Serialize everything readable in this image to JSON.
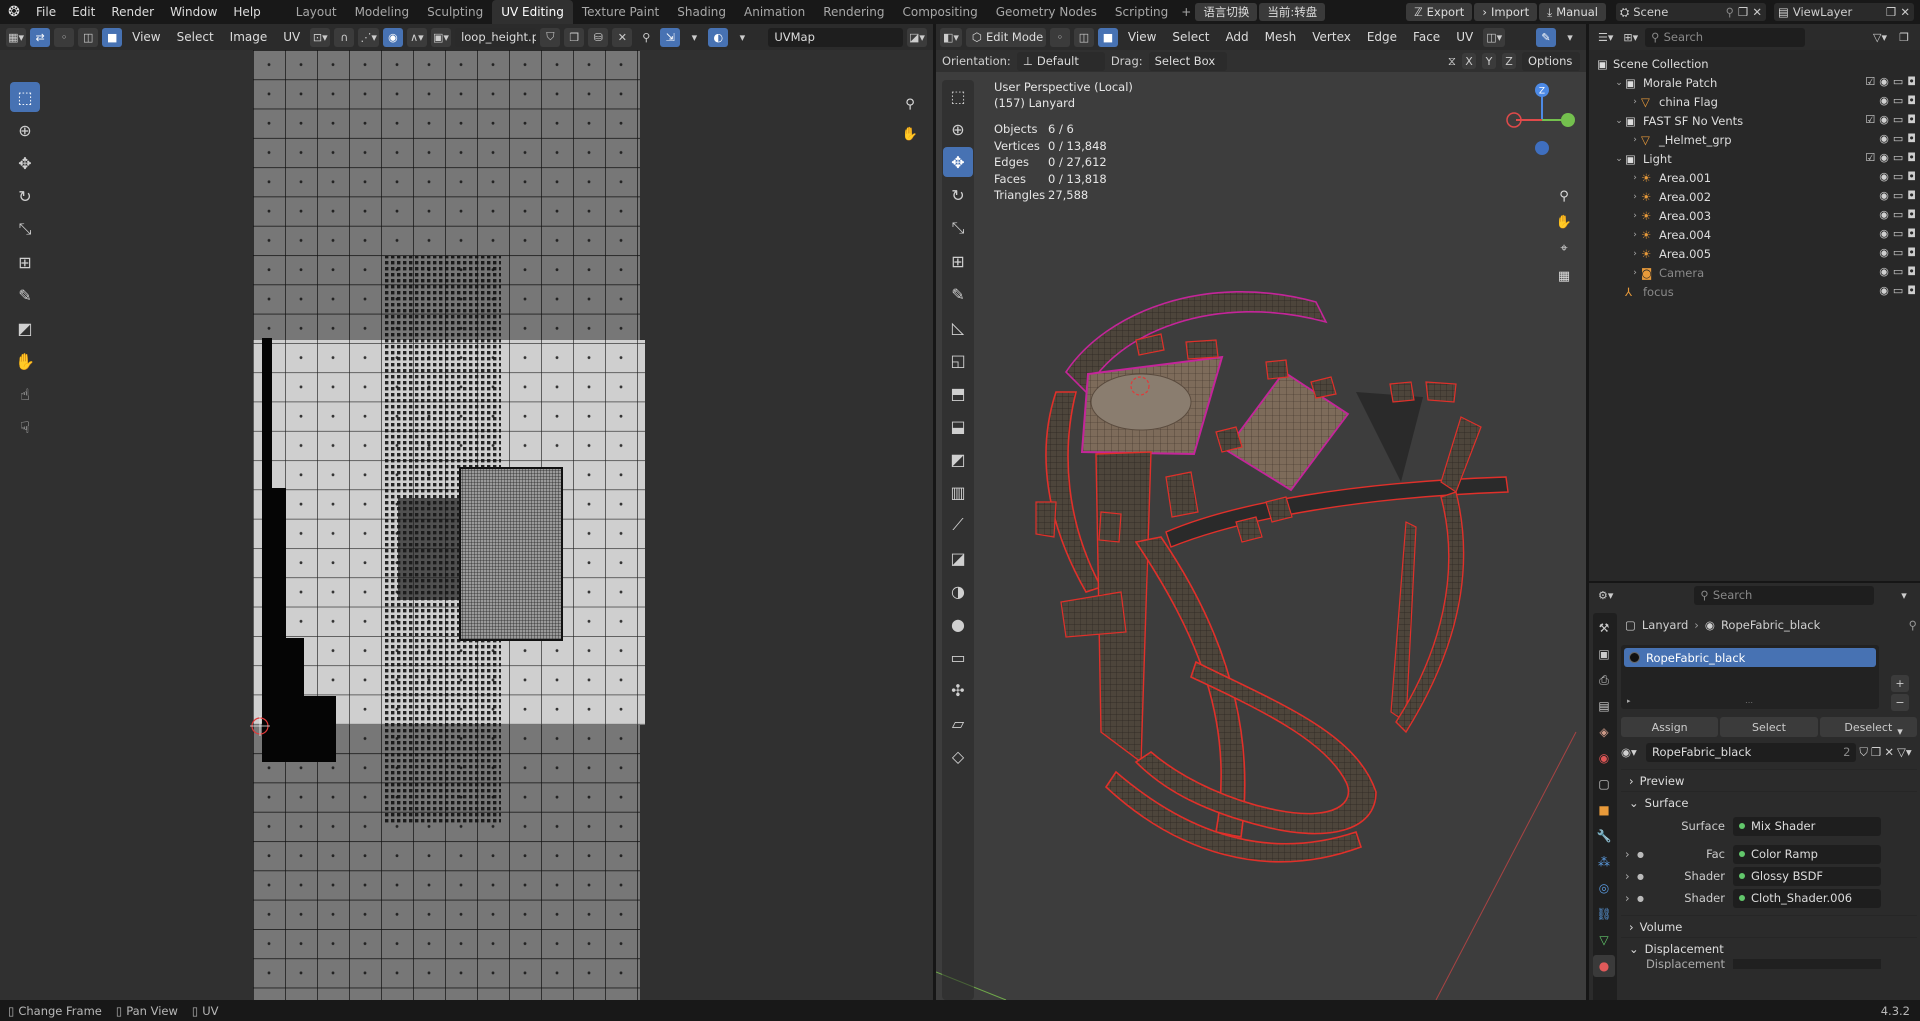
{
  "topbar": {
    "menus": [
      "File",
      "Edit",
      "Render",
      "Window",
      "Help"
    ],
    "workspaces": [
      "Layout",
      "Modeling",
      "Sculpting",
      "UV Editing",
      "Texture Paint",
      "Shading",
      "Animation",
      "Rendering",
      "Compositing",
      "Geometry Nodes",
      "Scripting"
    ],
    "active_workspace": "UV Editing",
    "plus": "+",
    "lang_switch": "语言切换",
    "lang_current": "当前:转盘",
    "export": "Export",
    "import": "Import",
    "manual": "Manual",
    "scene": "Scene",
    "view_layer": "ViewLayer"
  },
  "uv_editor": {
    "menus": [
      "View",
      "Select",
      "Image",
      "UV"
    ],
    "image_name": "loop_height.png",
    "uvmap": "UVMap"
  },
  "viewport": {
    "mode": "Edit Mode",
    "menus": [
      "View",
      "Select",
      "Add",
      "Mesh",
      "Vertex",
      "Edge",
      "Face",
      "UV"
    ],
    "orientation_label": "Orientation:",
    "orientation_value": "Default",
    "drag_label": "Drag:",
    "drag_value": "Select Box",
    "options": "Options",
    "axes": [
      "X",
      "Y",
      "Z"
    ],
    "perspective": "User Perspective (Local)",
    "object": "(157) Lanyard",
    "stats": [
      {
        "k": "Objects",
        "v": "6 / 6"
      },
      {
        "k": "Vertices",
        "v": "0 / 13,848"
      },
      {
        "k": "Edges",
        "v": "0 / 27,612"
      },
      {
        "k": "Faces",
        "v": "0 / 13,818"
      },
      {
        "k": "Triangles",
        "v": "27,588"
      }
    ],
    "gizmo_z": "Z"
  },
  "outliner": {
    "search_placeholder": "Search",
    "root": "Scene Collection",
    "rows": [
      {
        "label": "Morale Patch",
        "indent": 1,
        "type": "collection"
      },
      {
        "label": "china Flag",
        "indent": 2,
        "type": "object"
      },
      {
        "label": "FAST SF No Vents",
        "indent": 1,
        "type": "collection"
      },
      {
        "label": "_Helmet_grp",
        "indent": 2,
        "type": "object"
      },
      {
        "label": "Light",
        "indent": 1,
        "type": "collection"
      },
      {
        "label": "Area.001",
        "indent": 2,
        "type": "light"
      },
      {
        "label": "Area.002",
        "indent": 2,
        "type": "light"
      },
      {
        "label": "Area.003",
        "indent": 2,
        "type": "light"
      },
      {
        "label": "Area.004",
        "indent": 2,
        "type": "light"
      },
      {
        "label": "Area.005",
        "indent": 2,
        "type": "light"
      },
      {
        "label": "Camera",
        "indent": 2,
        "type": "camera"
      },
      {
        "label": "focus",
        "indent": 1,
        "type": "empty"
      }
    ]
  },
  "properties": {
    "search_placeholder": "Search",
    "breadcrumb_object": "Lanyard",
    "breadcrumb_material": "RopeFabric_black",
    "slot_selected": "RopeFabric_black",
    "assign": "Assign",
    "select": "Select",
    "deselect": "Deselect",
    "material_name": "RopeFabric_black",
    "user_count": "2",
    "preview": "Preview",
    "surface_panel": "Surface",
    "surface_label": "Surface",
    "surface_value": "Mix Shader",
    "inputs": [
      {
        "label": "Fac",
        "value": "Color Ramp"
      },
      {
        "label": "Shader",
        "value": "Glossy BSDF"
      },
      {
        "label": "Shader",
        "value": "Cloth_Shader.006"
      }
    ],
    "volume": "Volume",
    "displacement": "Displacement",
    "displacement_partial": "Displacement"
  },
  "statusbar": {
    "items": [
      "Change Frame",
      "Pan View",
      "UV"
    ],
    "version": "4.3.2"
  },
  "colors": {
    "accent": "#4772b3",
    "wire_edge": "#e0302a",
    "seam": "#c4259a",
    "mesh": "#4a4238"
  }
}
